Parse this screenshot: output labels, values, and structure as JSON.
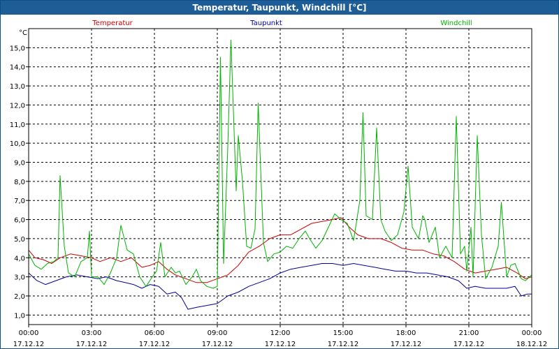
{
  "window": {
    "title": "Temperatur, Taupunkt, Windchill [°C]"
  },
  "colors": {
    "temperatur": "#cc0000",
    "taupunkt": "#00009a",
    "windchill": "#00b400",
    "titlebar": "#1f5d96"
  },
  "chart_data": {
    "type": "line",
    "unit": "°C",
    "ylim": [
      0.5,
      16.0
    ],
    "yticks": [
      "1,0",
      "2,0",
      "3,0",
      "4,0",
      "5,0",
      "6,0",
      "7,0",
      "8,0",
      "9,0",
      "10,0",
      "11,0",
      "12,0",
      "13,0",
      "14,0",
      "15,0"
    ],
    "xlim": [
      0,
      24
    ],
    "xticks": [
      {
        "time": "00:00",
        "date": "17.12.12"
      },
      {
        "time": "03:00",
        "date": "17.12.12"
      },
      {
        "time": "06:00",
        "date": "17.12.12"
      },
      {
        "time": "09:00",
        "date": "17.12.12"
      },
      {
        "time": "12:00",
        "date": "17.12.12"
      },
      {
        "time": "15:00",
        "date": "17.12.12"
      },
      {
        "time": "18:00",
        "date": "17.12.12"
      },
      {
        "time": "21:00",
        "date": "17.12.12"
      },
      {
        "time": "00:00",
        "date": "18.12.12"
      }
    ],
    "grid": true,
    "series": [
      {
        "name": "Temperatur",
        "color": "#cc0000",
        "points": [
          [
            0,
            4.4
          ],
          [
            0.3,
            4.0
          ],
          [
            0.7,
            3.9
          ],
          [
            1.1,
            3.7
          ],
          [
            1.5,
            4.0
          ],
          [
            2.0,
            4.2
          ],
          [
            2.5,
            4.1
          ],
          [
            3.0,
            4.0
          ],
          [
            3.4,
            3.8
          ],
          [
            3.9,
            4.0
          ],
          [
            4.4,
            3.8
          ],
          [
            4.9,
            4.0
          ],
          [
            5.4,
            3.5
          ],
          [
            5.8,
            3.6
          ],
          [
            6.2,
            3.8
          ],
          [
            6.6,
            3.4
          ],
          [
            7.0,
            3.1
          ],
          [
            7.5,
            2.9
          ],
          [
            8.0,
            2.7
          ],
          [
            8.5,
            2.7
          ],
          [
            9.0,
            2.9
          ],
          [
            9.5,
            3.1
          ],
          [
            10.0,
            3.6
          ],
          [
            10.5,
            4.3
          ],
          [
            11.0,
            4.6
          ],
          [
            11.5,
            5.0
          ],
          [
            12.0,
            5.2
          ],
          [
            12.5,
            5.2
          ],
          [
            13.0,
            5.5
          ],
          [
            13.5,
            5.8
          ],
          [
            14.0,
            5.9
          ],
          [
            14.5,
            6.0
          ],
          [
            14.9,
            6.1
          ],
          [
            15.3,
            5.6
          ],
          [
            15.7,
            5.2
          ],
          [
            16.2,
            5.0
          ],
          [
            16.8,
            5.0
          ],
          [
            17.3,
            4.8
          ],
          [
            17.8,
            4.5
          ],
          [
            18.3,
            4.4
          ],
          [
            18.8,
            4.4
          ],
          [
            19.3,
            4.2
          ],
          [
            19.8,
            4.1
          ],
          [
            20.3,
            3.8
          ],
          [
            20.8,
            3.4
          ],
          [
            21.3,
            3.2
          ],
          [
            21.8,
            3.3
          ],
          [
            22.3,
            3.4
          ],
          [
            22.8,
            3.5
          ],
          [
            23.3,
            3.2
          ],
          [
            23.7,
            2.9
          ],
          [
            24,
            3.0
          ]
        ]
      },
      {
        "name": "Taupunkt",
        "color": "#00009a",
        "points": [
          [
            0,
            3.2
          ],
          [
            0.4,
            2.8
          ],
          [
            0.8,
            2.6
          ],
          [
            1.3,
            2.8
          ],
          [
            1.8,
            3.0
          ],
          [
            2.3,
            3.1
          ],
          [
            2.8,
            3.0
          ],
          [
            3.3,
            2.9
          ],
          [
            3.7,
            3.0
          ],
          [
            4.2,
            2.8
          ],
          [
            4.6,
            2.7
          ],
          [
            5.0,
            2.6
          ],
          [
            5.4,
            2.4
          ],
          [
            5.8,
            2.6
          ],
          [
            6.2,
            2.5
          ],
          [
            6.6,
            2.1
          ],
          [
            7.0,
            2.2
          ],
          [
            7.3,
            1.9
          ],
          [
            7.6,
            1.3
          ],
          [
            8.0,
            1.4
          ],
          [
            8.5,
            1.5
          ],
          [
            9.0,
            1.6
          ],
          [
            9.5,
            2.0
          ],
          [
            10.0,
            2.2
          ],
          [
            10.5,
            2.5
          ],
          [
            11.0,
            2.7
          ],
          [
            11.5,
            2.9
          ],
          [
            12.0,
            3.2
          ],
          [
            12.5,
            3.4
          ],
          [
            13.0,
            3.5
          ],
          [
            13.5,
            3.6
          ],
          [
            14.0,
            3.7
          ],
          [
            14.5,
            3.7
          ],
          [
            15.0,
            3.6
          ],
          [
            15.5,
            3.7
          ],
          [
            16.0,
            3.6
          ],
          [
            16.5,
            3.5
          ],
          [
            17.0,
            3.4
          ],
          [
            17.5,
            3.3
          ],
          [
            18.0,
            3.3
          ],
          [
            18.5,
            3.2
          ],
          [
            19.0,
            3.2
          ],
          [
            19.5,
            3.1
          ],
          [
            20.0,
            3.0
          ],
          [
            20.5,
            2.8
          ],
          [
            20.9,
            2.4
          ],
          [
            21.3,
            2.5
          ],
          [
            21.8,
            2.4
          ],
          [
            22.3,
            2.4
          ],
          [
            22.8,
            2.4
          ],
          [
            23.2,
            2.5
          ],
          [
            23.5,
            2.0
          ],
          [
            23.8,
            2.1
          ],
          [
            24,
            2.1
          ]
        ]
      },
      {
        "name": "Windchill",
        "color": "#00b400",
        "points": [
          [
            0,
            4.2
          ],
          [
            0.3,
            3.6
          ],
          [
            0.6,
            3.4
          ],
          [
            0.9,
            3.7
          ],
          [
            1.2,
            3.8
          ],
          [
            1.4,
            4.0
          ],
          [
            1.5,
            8.3
          ],
          [
            1.7,
            4.6
          ],
          [
            1.9,
            3.2
          ],
          [
            2.2,
            3.0
          ],
          [
            2.5,
            3.8
          ],
          [
            2.8,
            4.0
          ],
          [
            2.9,
            5.4
          ],
          [
            3.0,
            3.0
          ],
          [
            3.3,
            3.0
          ],
          [
            3.6,
            2.6
          ],
          [
            3.9,
            3.2
          ],
          [
            4.2,
            4.0
          ],
          [
            4.4,
            5.7
          ],
          [
            4.7,
            4.4
          ],
          [
            5.0,
            4.2
          ],
          [
            5.3,
            3.0
          ],
          [
            5.6,
            2.5
          ],
          [
            5.9,
            3.0
          ],
          [
            6.1,
            3.3
          ],
          [
            6.3,
            4.8
          ],
          [
            6.5,
            3.0
          ],
          [
            6.8,
            3.5
          ],
          [
            7.0,
            3.2
          ],
          [
            7.2,
            3.3
          ],
          [
            7.5,
            2.6
          ],
          [
            7.8,
            3.0
          ],
          [
            8.0,
            3.4
          ],
          [
            8.2,
            2.8
          ],
          [
            8.5,
            2.5
          ],
          [
            8.8,
            2.4
          ],
          [
            9.0,
            2.5
          ],
          [
            9.15,
            14.5
          ],
          [
            9.3,
            3.7
          ],
          [
            9.5,
            9.8
          ],
          [
            9.65,
            15.4
          ],
          [
            9.9,
            7.5
          ],
          [
            10.0,
            10.4
          ],
          [
            10.2,
            8.0
          ],
          [
            10.4,
            4.6
          ],
          [
            10.6,
            4.5
          ],
          [
            10.8,
            5.5
          ],
          [
            10.95,
            12.1
          ],
          [
            11.2,
            4.8
          ],
          [
            11.4,
            3.8
          ],
          [
            11.7,
            4.2
          ],
          [
            12.0,
            4.3
          ],
          [
            12.3,
            4.6
          ],
          [
            12.6,
            4.5
          ],
          [
            12.9,
            5.0
          ],
          [
            13.2,
            5.4
          ],
          [
            13.4,
            5.0
          ],
          [
            13.7,
            4.5
          ],
          [
            14.0,
            4.9
          ],
          [
            14.3,
            5.6
          ],
          [
            14.6,
            6.3
          ],
          [
            14.9,
            6.0
          ],
          [
            15.2,
            5.8
          ],
          [
            15.5,
            4.9
          ],
          [
            15.8,
            7.0
          ],
          [
            15.95,
            11.6
          ],
          [
            16.1,
            6.2
          ],
          [
            16.4,
            6.0
          ],
          [
            16.6,
            10.8
          ],
          [
            16.8,
            6.0
          ],
          [
            17.0,
            5.4
          ],
          [
            17.3,
            4.9
          ],
          [
            17.6,
            5.2
          ],
          [
            17.9,
            6.4
          ],
          [
            18.1,
            8.8
          ],
          [
            18.3,
            5.6
          ],
          [
            18.6,
            5.0
          ],
          [
            18.8,
            6.2
          ],
          [
            18.9,
            6.0
          ],
          [
            19.1,
            4.8
          ],
          [
            19.4,
            5.6
          ],
          [
            19.6,
            4.0
          ],
          [
            19.9,
            4.6
          ],
          [
            20.2,
            4.0
          ],
          [
            20.4,
            11.4
          ],
          [
            20.6,
            4.2
          ],
          [
            20.8,
            4.6
          ],
          [
            20.9,
            3.3
          ],
          [
            21.1,
            5.6
          ],
          [
            21.2,
            3.0
          ],
          [
            21.4,
            10.4
          ],
          [
            21.6,
            5.2
          ],
          [
            21.8,
            2.9
          ],
          [
            22.1,
            3.5
          ],
          [
            22.4,
            4.6
          ],
          [
            22.55,
            6.9
          ],
          [
            22.8,
            3.0
          ],
          [
            23.0,
            3.6
          ],
          [
            23.2,
            3.7
          ],
          [
            23.5,
            2.9
          ],
          [
            23.7,
            2.8
          ],
          [
            24,
            3.1
          ]
        ]
      }
    ]
  }
}
